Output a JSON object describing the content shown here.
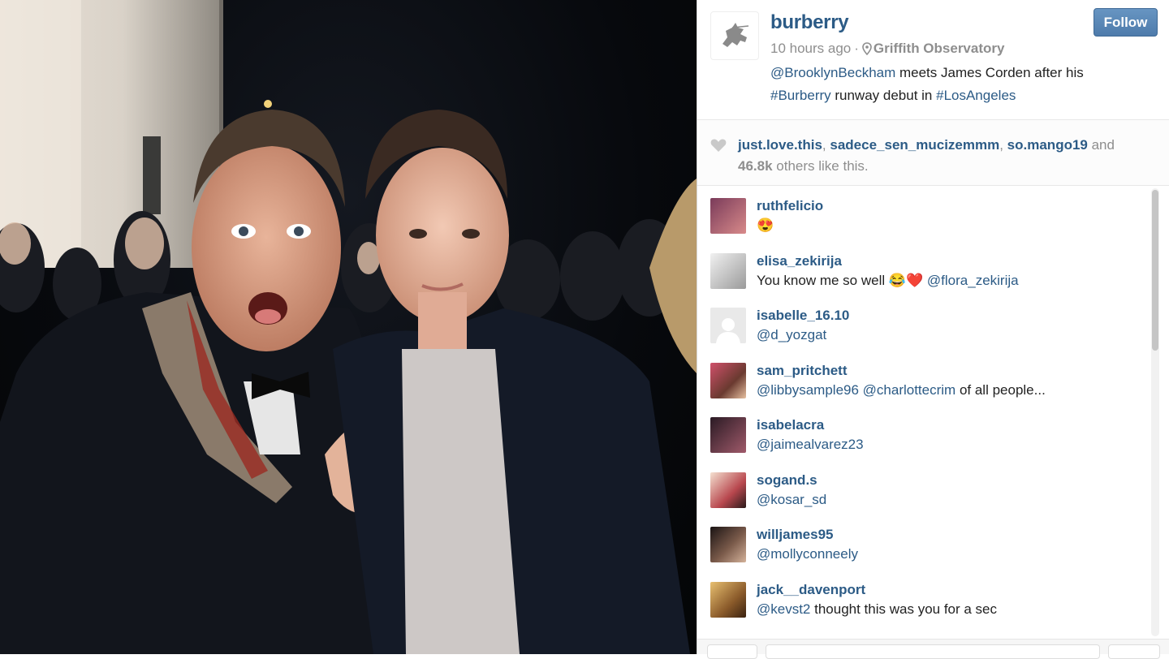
{
  "post": {
    "username": "burberry",
    "time_ago": "10 hours ago",
    "separator": "·",
    "location": "Griffith Observatory",
    "follow_label": "Follow",
    "caption": {
      "mention": "@BrooklynBeckham",
      "text1": " meets James Corden after his",
      "hashtag1": "#Burberry",
      "text2": " runway debut in ",
      "hashtag2": "#LosAngeles"
    }
  },
  "likes": {
    "users": [
      "just.love.this",
      "sadece_sen_mucizemmm",
      "so.mango19"
    ],
    "sep": ", ",
    "and": " and",
    "count": "46.8k",
    "suffix": " others like this."
  },
  "comments": [
    {
      "user": "ruthfelicio",
      "text": "😍",
      "avatar_color": "#7a3b5a"
    },
    {
      "user": "elisa_zekirija",
      "text": "You know me so well 😂❤️ ",
      "mention": "@flora_zekirija",
      "avatar_color": "#cfcfcf"
    },
    {
      "user": "isabelle_16.10",
      "text": "",
      "mention": "@d_yozgat",
      "avatar_color": "#e9e9e9"
    },
    {
      "user": "sam_pritchett",
      "text": " of all people...",
      "mention": "@libbysample96 @charlottecrim",
      "avatar_color": "#9a4a3a"
    },
    {
      "user": "isabelacra",
      "text": "",
      "mention": "@jaimealvarez23",
      "avatar_color": "#5a2e3a"
    },
    {
      "user": "sogand.s",
      "text": "",
      "mention": "@kosar_sd",
      "avatar_color": "#b8474e"
    },
    {
      "user": "willjames95",
      "text": "",
      "mention": "@mollyconneely",
      "avatar_color": "#3a2a2a"
    },
    {
      "user": "jack__davenport",
      "text": " thought this was you for a sec",
      "mention": "@kevst2",
      "avatar_color": "#c79a3a"
    }
  ],
  "colors": {
    "link": "#2c5b86",
    "follow_button": "#5a87b6",
    "muted": "#8e8e8e"
  }
}
